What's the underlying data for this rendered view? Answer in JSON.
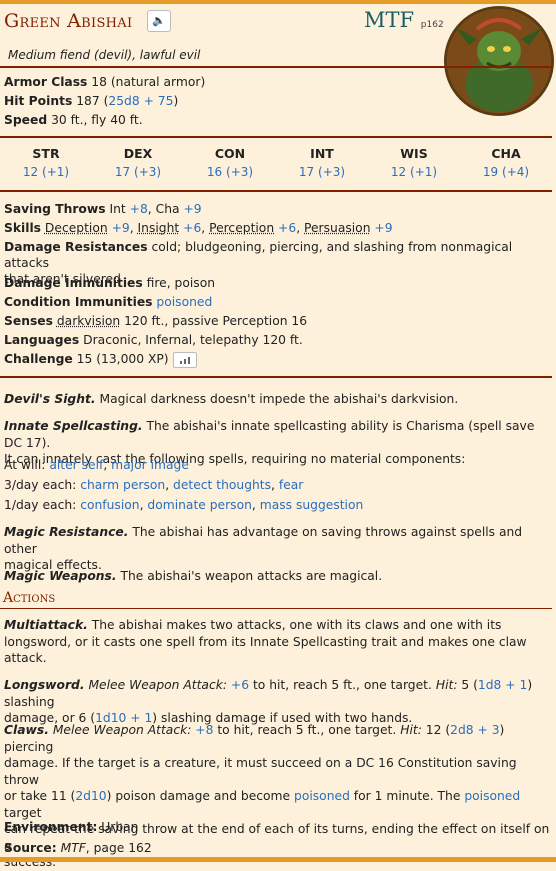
{
  "name": "Green Abishai",
  "source_book": "MTF",
  "source_page": "p162",
  "meta": "Medium fiend (devil), lawful evil",
  "armor_class": {
    "label": "Armor Class",
    "value": "18 (natural armor)"
  },
  "hit_points": {
    "label": "Hit Points",
    "value_pre": "187 (",
    "dice": "25d8 + 75",
    "value_post": ")"
  },
  "speed": {
    "label": "Speed",
    "value": "30 ft., fly 40 ft."
  },
  "abilities": [
    {
      "name": "STR",
      "value": "12 (+1)"
    },
    {
      "name": "DEX",
      "value": "17 (+3)"
    },
    {
      "name": "CON",
      "value": "16 (+3)"
    },
    {
      "name": "INT",
      "value": "17 (+3)"
    },
    {
      "name": "WIS",
      "value": "12 (+1)"
    },
    {
      "name": "CHA",
      "value": "19 (+4)"
    }
  ],
  "saving_throws": {
    "label": "Saving Throws",
    "int": "Int",
    "int_mod": "+8",
    "cha": "Cha",
    "cha_mod": "+9"
  },
  "skills": {
    "label": "Skills",
    "items": [
      {
        "name": "Deception",
        "mod": "+9"
      },
      {
        "name": "Insight",
        "mod": "+6"
      },
      {
        "name": "Perception",
        "mod": "+6"
      },
      {
        "name": "Persuasion",
        "mod": "+9"
      }
    ]
  },
  "damage_resistances": {
    "label": "Damage Resistances",
    "value1": "cold; bludgeoning, piercing, and slashing from nonmagical attacks",
    "value2": "that aren't silvered"
  },
  "damage_immunities": {
    "label": "Damage Immunities",
    "value": "fire, poison"
  },
  "condition_immunities": {
    "label": "Condition Immunities",
    "value": "poisoned"
  },
  "senses": {
    "label": "Senses",
    "link": "darkvision",
    "value": "120 ft., passive Perception 16"
  },
  "languages": {
    "label": "Languages",
    "value": "Draconic, Infernal, telepathy 120 ft."
  },
  "challenge": {
    "label": "Challenge",
    "value": "15 (13,000 XP)"
  },
  "traits": {
    "devils_sight": {
      "name": "Devil's Sight.",
      "text": "Magical darkness doesn't impede the abishai's darkvision."
    },
    "innate": {
      "name": "Innate Spellcasting.",
      "text1": "The abishai's innate spellcasting ability is Charisma (spell save DC 17).",
      "text2": "It can innately cast the following spells, requiring no material components:"
    },
    "at_will": {
      "label": "At will:",
      "s1": "alter self",
      "s2": "major image"
    },
    "three_day": {
      "label": "3/day each:",
      "s1": "charm person",
      "s2": "detect thoughts",
      "s3": "fear"
    },
    "one_day": {
      "label": "1/day each:",
      "s1": "confusion",
      "s2": "dominate person",
      "s3": "mass suggestion"
    },
    "magic_resistance": {
      "name": "Magic Resistance.",
      "text1": "The abishai has advantage on saving throws against spells and other",
      "text2": "magical effects."
    },
    "magic_weapons": {
      "name": "Magic Weapons.",
      "text": "The abishai's weapon attacks are magical."
    }
  },
  "actions_title": "Actions",
  "actions": {
    "multiattack": {
      "name": "Multiattack.",
      "text1": "The abishai makes two attacks, one with its claws and one with its",
      "text2": "longsword, or it casts one spell from its Innate Spellcasting trait and makes one claw",
      "text3": "attack."
    },
    "longsword": {
      "name": "Longsword.",
      "atk": "Melee Weapon Attack:",
      "to_hit": "+6",
      "t1": "to hit, reach 5 ft., one target.",
      "hit": "Hit:",
      "t2": "5 (",
      "d1": "1d8 + 1",
      "t3": ") slashing",
      "t4": "damage, or 6 (",
      "d2": "1d10 + 1",
      "t5": ") slashing damage if used with two hands."
    },
    "claws": {
      "name": "Claws.",
      "atk": "Melee Weapon Attack:",
      "to_hit": "+8",
      "t1": "to hit, reach 5 ft., one target.",
      "hit": "Hit:",
      "t2": "12 (",
      "d1": "2d8 + 3",
      "t3": ") piercing",
      "l2": "damage. If the target is a creature, it must succeed on a DC 16 Constitution saving throw",
      "l3a": "or take 11 (",
      "d2": "2d10",
      "l3b": ") poison damage and become",
      "cond": "poisoned",
      "l3c": "for 1 minute. The",
      "cond2": "poisoned",
      "l3d": "target",
      "l4": "can repeat the saving throw at the end of each of its turns, ending the effect on itself on a",
      "l5": "success."
    }
  },
  "environment": {
    "label": "Environment:",
    "value": "Urban"
  },
  "source": {
    "label": "Source:",
    "book": "MTF",
    "value": ", page 162"
  },
  "icons": {
    "speaker": "speaker-icon",
    "cr": "bar-chart-icon"
  },
  "colors": {
    "accent": "#822000",
    "link": "#2a6ebb",
    "bar": "#e69a28",
    "bg": "#fdf1dc"
  }
}
